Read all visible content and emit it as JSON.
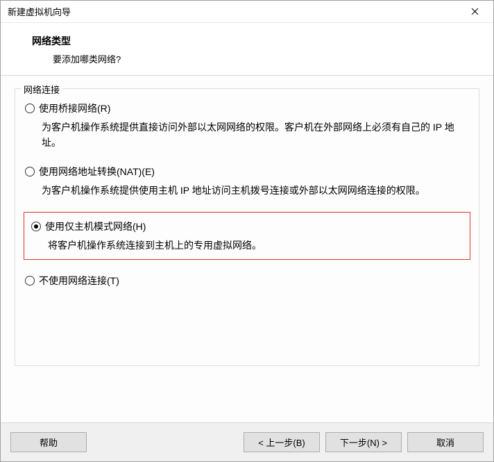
{
  "window": {
    "title": "新建虚拟机向导"
  },
  "header": {
    "title": "网络类型",
    "subtitle": "要添加哪类网络?"
  },
  "group": {
    "legend": "网络连接"
  },
  "options": {
    "bridged": {
      "label": "使用桥接网络(R)",
      "desc": "为客户机操作系统提供直接访问外部以太网网络的权限。客户机在外部网络上必须有自己的 IP 地址。"
    },
    "nat": {
      "label": "使用网络地址转换(NAT)(E)",
      "desc": "为客户机操作系统提供使用主机 IP 地址访问主机拨号连接或外部以太网网络连接的权限。"
    },
    "hostonly": {
      "label": "使用仅主机模式网络(H)",
      "desc": "将客户机操作系统连接到主机上的专用虚拟网络。"
    },
    "none": {
      "label": "不使用网络连接(T)"
    }
  },
  "footer": {
    "help": "帮助",
    "back": "< 上一步(B)",
    "next": "下一步(N) >",
    "cancel": "取消"
  }
}
